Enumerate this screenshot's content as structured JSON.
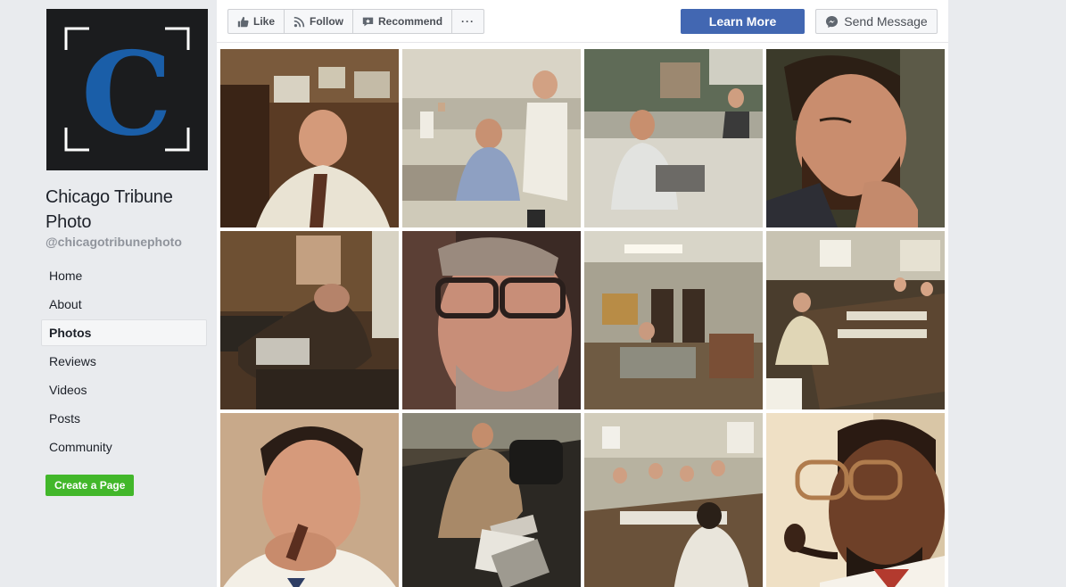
{
  "page": {
    "name": "Chicago Tribune Photo",
    "handle": "@chicagotribunephoto",
    "logo_letter": "C"
  },
  "nav": {
    "items": [
      {
        "label": "Home"
      },
      {
        "label": "About"
      },
      {
        "label": "Photos",
        "active": true
      },
      {
        "label": "Reviews"
      },
      {
        "label": "Videos"
      },
      {
        "label": "Posts"
      },
      {
        "label": "Community"
      }
    ],
    "create_page": "Create a Page"
  },
  "actions": {
    "like": "Like",
    "follow": "Follow",
    "recommend": "Recommend",
    "more": "···",
    "learn_more": "Learn More",
    "send_message": "Send Message"
  },
  "colors": {
    "brand_blue": "#4267b2",
    "create_green": "#42b72a",
    "logo_blue": "#1a5ea8",
    "page_bg": "#e9ebee"
  },
  "photos": [
    {
      "subject": "man in white shirt looking up, office"
    },
    {
      "subject": "newsroom desks with workers"
    },
    {
      "subject": "man typing at desk in newsroom"
    },
    {
      "subject": "close-up bearded man resting head on hand"
    },
    {
      "subject": "man leaning back at cluttered desk"
    },
    {
      "subject": "close-up older man with glasses"
    },
    {
      "subject": "office room with desks"
    },
    {
      "subject": "meeting around long table"
    },
    {
      "subject": "man smoking cigar"
    },
    {
      "subject": "man in car with photographs"
    },
    {
      "subject": "newsroom meeting group"
    },
    {
      "subject": "man with glasses smoking pipe"
    }
  ]
}
